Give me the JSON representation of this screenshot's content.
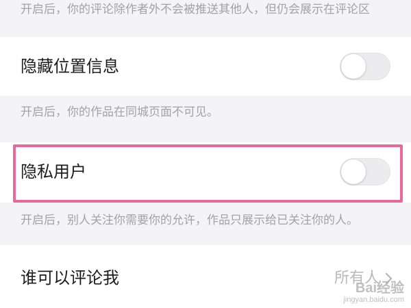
{
  "settings": {
    "top_description": "开启后，你的评论除作者外不会被推送其他人，但仍会展示在评论区",
    "hide_location": {
      "label": "隐藏位置信息",
      "enabled": false,
      "description": "开启后，你的作品在同城页面不可见。"
    },
    "private_account": {
      "label": "隐私用户",
      "enabled": false,
      "description": "开启后，别人关注你需要你的允许，作品只展示给已关注你的人。"
    },
    "who_can_comment": {
      "label": "谁可以评论我",
      "value": "所有人"
    }
  },
  "watermark": {
    "brand": "Bai经验",
    "url": "jingyan.baidu.com"
  },
  "colors": {
    "highlight": "#e6699a",
    "toggle_off": "#ececef",
    "page_bg": "#f4f4f6"
  }
}
